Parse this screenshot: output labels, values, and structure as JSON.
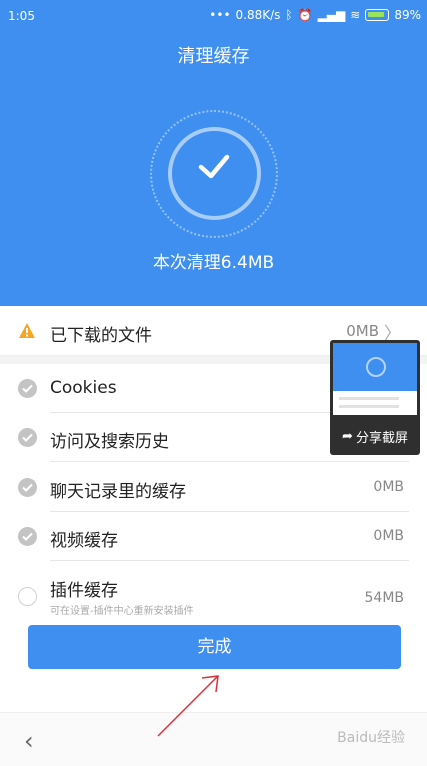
{
  "statusbar": {
    "time": "1:05",
    "network_speed": "0.88K/s",
    "battery": "89%"
  },
  "header": {
    "title": "清理缓存",
    "result_text": "本次清理6.4MB"
  },
  "downloads": {
    "label": "已下载的文件",
    "size": "0MB"
  },
  "items": [
    {
      "label": "Cookies",
      "size": ""
    },
    {
      "label": "访问及搜索历史",
      "size": ""
    },
    {
      "label": "聊天记录里的缓存",
      "size": "0MB"
    },
    {
      "label": "视频缓存",
      "size": "0MB"
    },
    {
      "label": "插件缓存",
      "size": "54MB",
      "sub": "可在设置-插件中心重新安装插件"
    }
  ],
  "done_label": "完成",
  "screenshot_thumb": {
    "share_label": "分享截屏"
  },
  "watermark": "Baidu经验",
  "colors": {
    "accent": "#3e8ff0",
    "warning": "#f5a623"
  }
}
